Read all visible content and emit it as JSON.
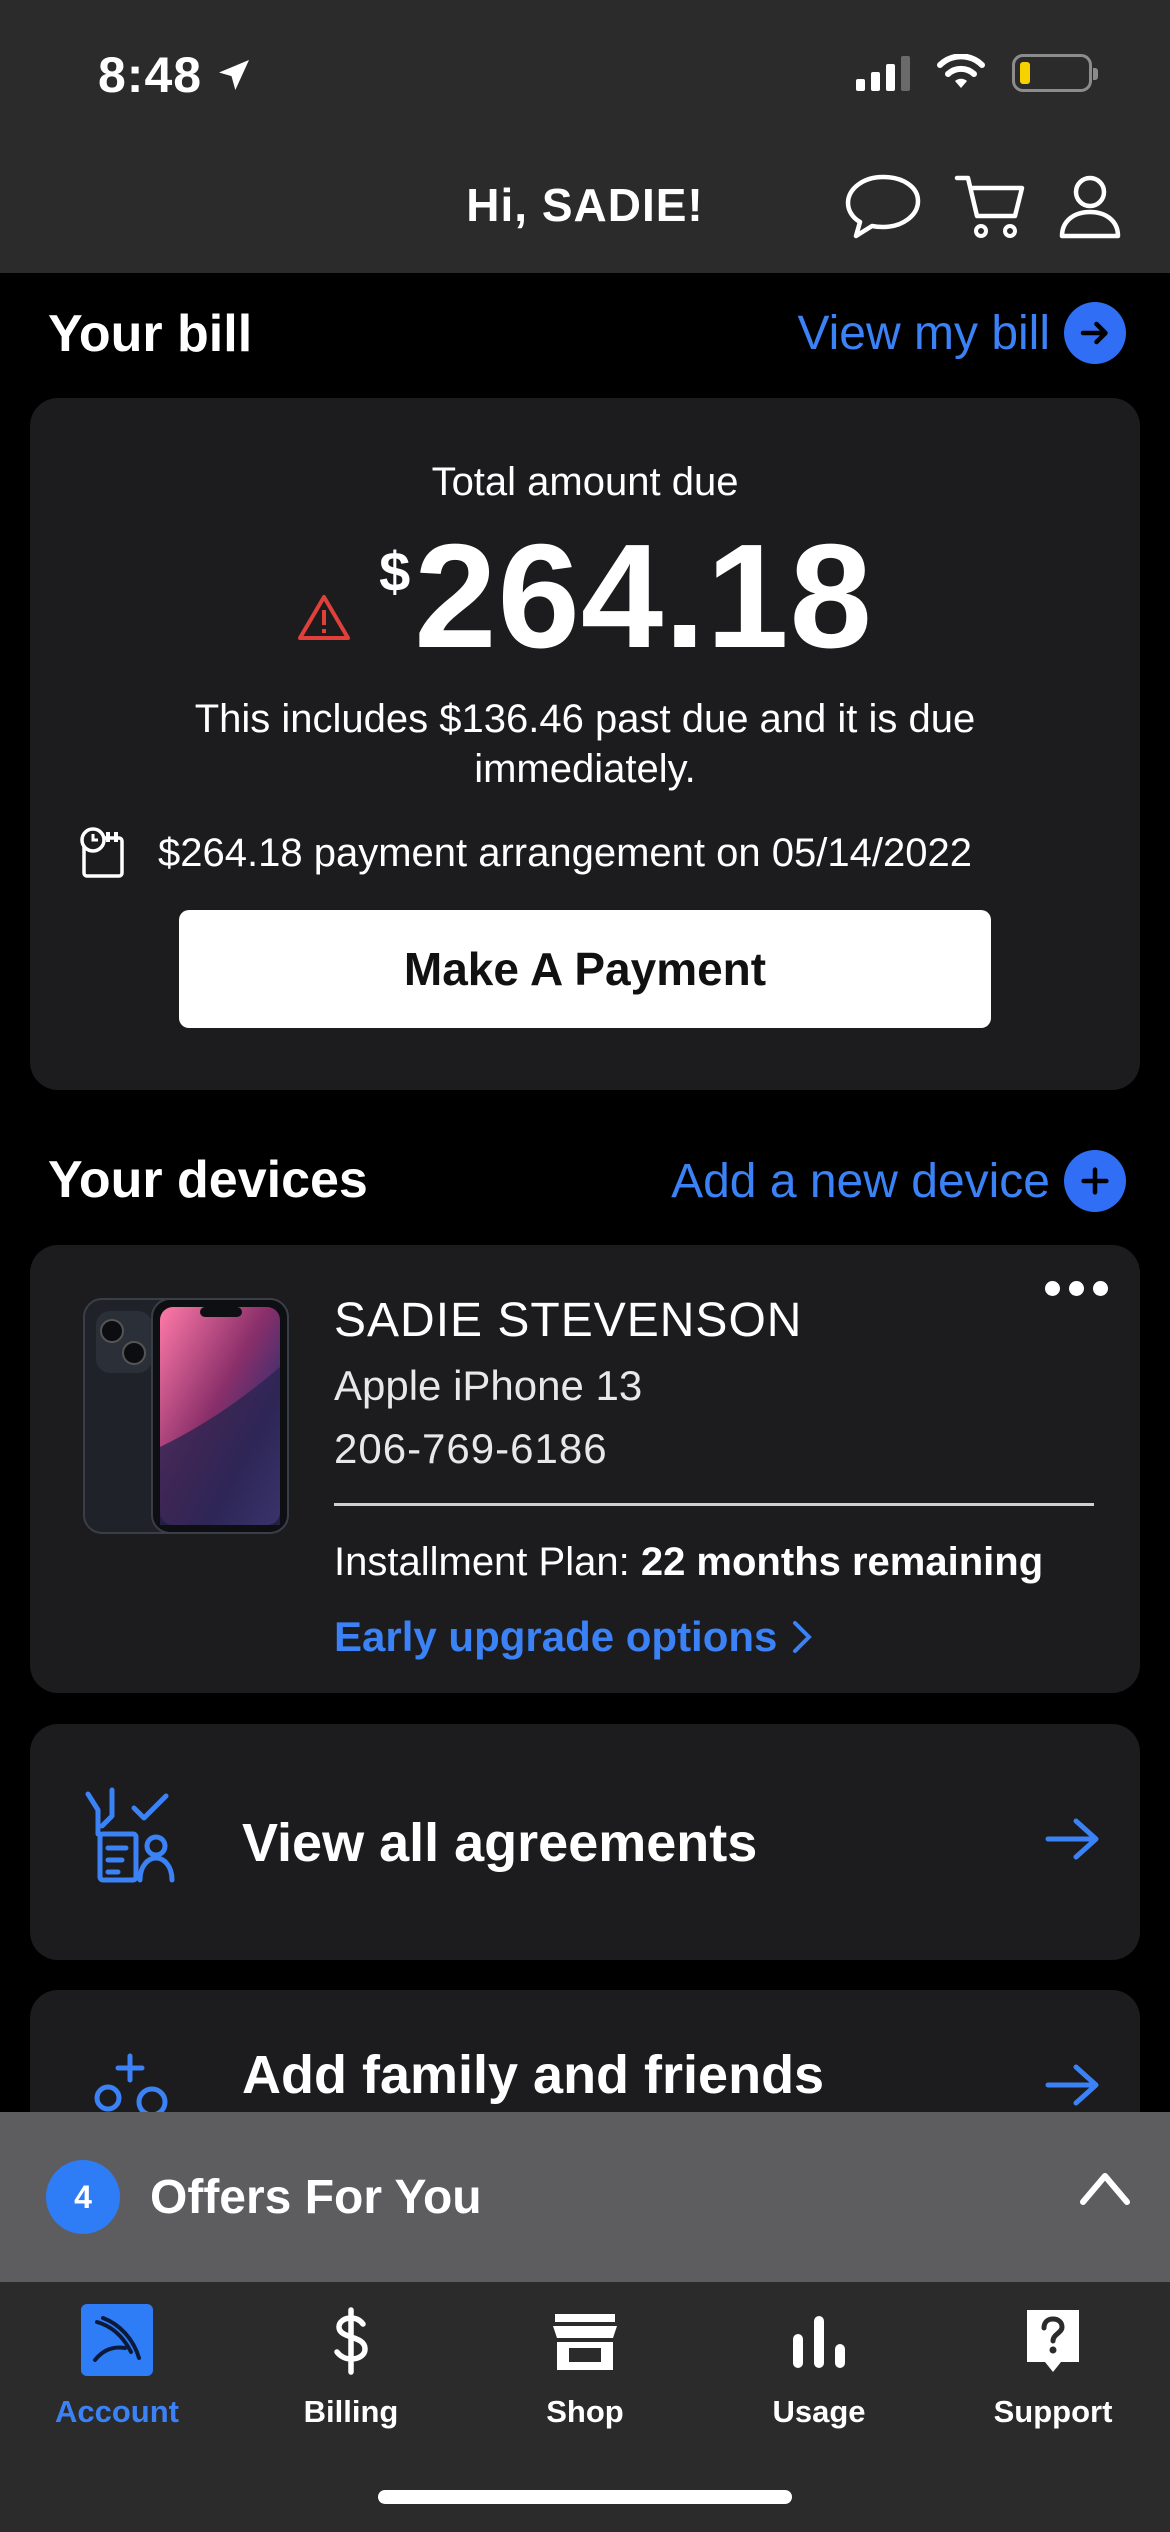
{
  "status_bar": {
    "time": "8:48"
  },
  "header": {
    "greeting": "Hi, SADIE!"
  },
  "bill": {
    "section_title": "Your bill",
    "view_link": "View my bill",
    "total_label": "Total amount due",
    "currency": "$",
    "amount": "264.18",
    "past_due_note": "This includes $136.46 past due and it is due immediately.",
    "arrangement": "$264.18 payment arrangement on 05/14/2022",
    "pay_button": "Make A Payment"
  },
  "devices": {
    "section_title": "Your devices",
    "add_link": "Add a new device",
    "device": {
      "owner": "SADIE STEVENSON",
      "model": "Apple iPhone 13",
      "phone_number": "206-769-6186",
      "plan_label": "Installment Plan:",
      "plan_value": "22 months remaining",
      "upgrade_link": "Early upgrade options"
    }
  },
  "agreements": {
    "label": "View all agreements"
  },
  "family": {
    "label": "Add family and friends"
  },
  "offers": {
    "count": "4",
    "label": "Offers For You"
  },
  "tabs": [
    {
      "label": "Account",
      "icon": "sprint-logo-icon",
      "active": true
    },
    {
      "label": "Billing",
      "icon": "dollar-icon"
    },
    {
      "label": "Shop",
      "icon": "store-icon"
    },
    {
      "label": "Usage",
      "icon": "bar-chart-icon"
    },
    {
      "label": "Support",
      "icon": "help-icon"
    }
  ],
  "colors": {
    "accent": "#3b82f6",
    "warning": "#e0403a",
    "battery": "#f6d300"
  }
}
